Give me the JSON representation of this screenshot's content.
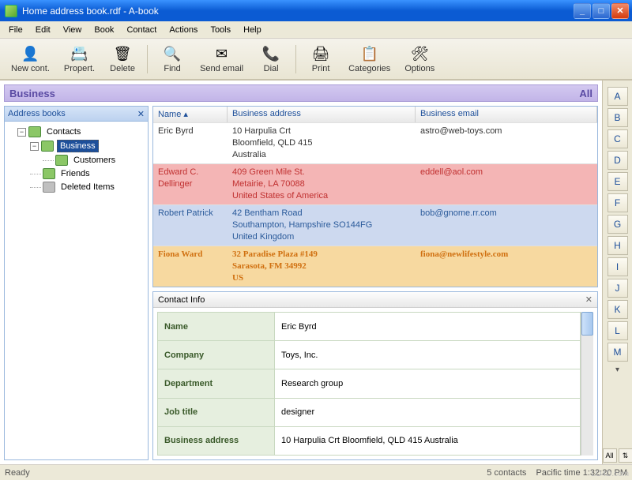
{
  "window": {
    "title": "Home address book.rdf - A-book"
  },
  "menu": [
    "File",
    "Edit",
    "View",
    "Book",
    "Contact",
    "Actions",
    "Tools",
    "Help"
  ],
  "toolbar": [
    {
      "icon": "👤",
      "label": "New cont."
    },
    {
      "icon": "📇",
      "label": "Propert."
    },
    {
      "icon": "🗑",
      "label": "Delete"
    },
    {
      "sep": true
    },
    {
      "icon": "🔍",
      "label": "Find"
    },
    {
      "icon": "✉",
      "label": "Send email"
    },
    {
      "icon": "📞",
      "label": "Dial"
    },
    {
      "sep": true
    },
    {
      "icon": "🖨",
      "label": "Print"
    },
    {
      "icon": "📋",
      "label": "Categories"
    },
    {
      "icon": "🛠",
      "label": "Options"
    }
  ],
  "filter": {
    "title": "Business",
    "mode": "All"
  },
  "sidebar": {
    "title": "Address books",
    "nodes": {
      "contacts": "Contacts",
      "business": "Business",
      "customers": "Customers",
      "friends": "Friends",
      "deleted": "Deleted Items"
    }
  },
  "grid": {
    "headers": [
      "Name ▴",
      "Business address",
      "Business email"
    ],
    "rows": [
      {
        "cells": [
          "Eric Byrd",
          "10 Harpulia Crt\nBloomfield, QLD 415\nAustralia",
          "astro@web-toys.com"
        ]
      },
      {
        "cells": [
          "Edward C. Dellinger",
          "409 Green Mile St.\nMetairie, LA 70088\nUnited States of America",
          "eddell@aol.com"
        ]
      },
      {
        "cells": [
          "Robert Patrick",
          "42 Bentham Road\nSouthampton, Hampshire SO144FG\nUnited Kingdom",
          "bob@gnome.rr.com"
        ]
      },
      {
        "cells": [
          "Fiona Ward",
          "32 Paradise Plaza #149\nSarasota, FM 34992\nUS",
          "fiona@newlifestyle.com"
        ]
      }
    ]
  },
  "info": {
    "title": "Contact Info",
    "rows": [
      [
        "Name",
        "Eric Byrd"
      ],
      [
        "Company",
        "Toys, Inc."
      ],
      [
        "Department",
        "Research group"
      ],
      [
        "Job title",
        "designer"
      ],
      [
        "Business address",
        "10 Harpulia Crt Bloomfield, QLD 415 Australia"
      ]
    ]
  },
  "alphabet": [
    "A",
    "B",
    "C",
    "D",
    "E",
    "F",
    "G",
    "H",
    "I",
    "J",
    "K",
    "L",
    "M"
  ],
  "alpha_bottom": {
    "all": "All",
    "arrows": "⇅"
  },
  "status": {
    "left": "Ready",
    "count": "5 contacts",
    "time": "Pacific time 1:32:20 PM"
  },
  "watermark": "LO4D.com"
}
